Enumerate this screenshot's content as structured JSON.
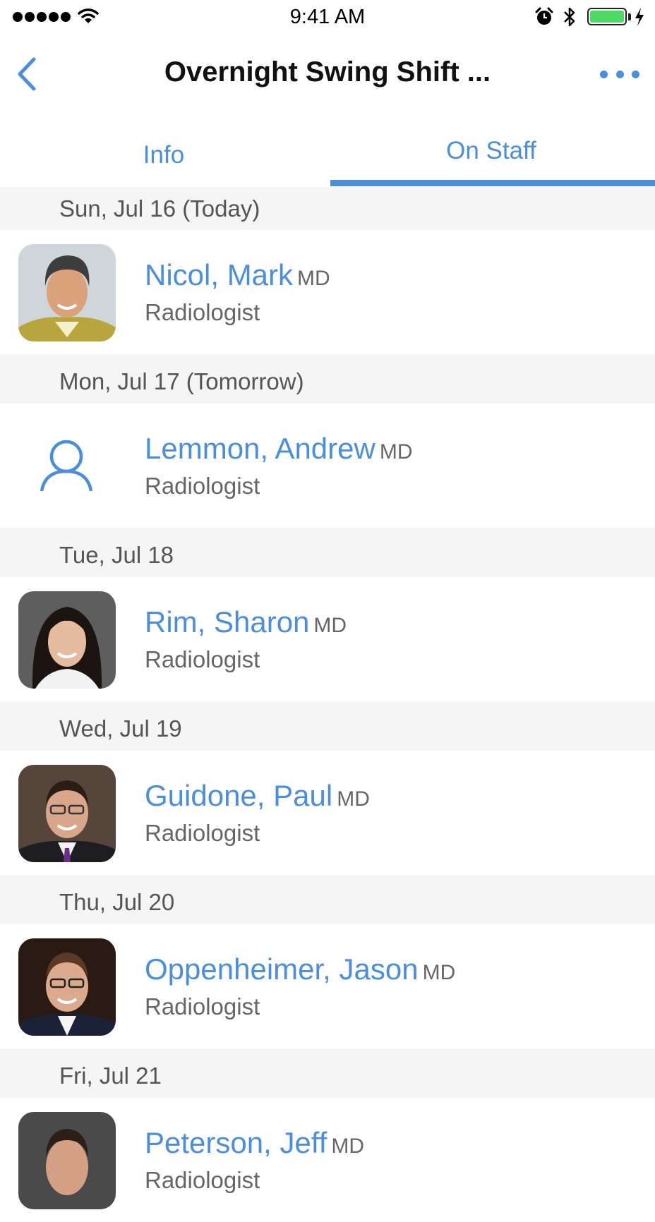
{
  "status_bar": {
    "time": "9:41 AM",
    "signal_icon": "signal-dots-icon",
    "wifi_icon": "wifi-icon",
    "alarm_icon": "alarm-clock-icon",
    "bluetooth_icon": "bluetooth-icon",
    "battery_icon": "battery-icon",
    "charging_icon": "charging-bolt-icon",
    "battery_color": "#4cd964"
  },
  "nav": {
    "title": "Overnight Swing Shift ...",
    "back_icon": "chevron-left-icon",
    "more_icon": "ellipsis-icon"
  },
  "tabs": [
    {
      "label": "Info",
      "active": false
    },
    {
      "label": "On Staff",
      "active": true
    }
  ],
  "colors": {
    "accent": "#4a8edc",
    "section_bg": "#f5f5f5",
    "secondary_text": "#666666"
  },
  "schedule": [
    {
      "date": "Sun, Jul 16 (Today)",
      "name": "Nicol, Mark",
      "degree": "MD",
      "role": "Radiologist",
      "avatar": "photo"
    },
    {
      "date": "Mon, Jul 17 (Tomorrow)",
      "name": "Lemmon, Andrew",
      "degree": "MD",
      "role": "Radiologist",
      "avatar": "person-placeholder-icon"
    },
    {
      "date": "Tue, Jul 18",
      "name": "Rim, Sharon",
      "degree": "MD",
      "role": "Radiologist",
      "avatar": "photo"
    },
    {
      "date": "Wed, Jul 19",
      "name": "Guidone, Paul",
      "degree": "MD",
      "role": "Radiologist",
      "avatar": "photo"
    },
    {
      "date": "Thu, Jul 20",
      "name": "Oppenheimer, Jason",
      "degree": "MD",
      "role": "Radiologist",
      "avatar": "photo"
    },
    {
      "date": "Fri, Jul 21",
      "name": "Peterson, Jeff",
      "degree": "MD",
      "role": "Radiologist",
      "avatar": "photo"
    }
  ]
}
